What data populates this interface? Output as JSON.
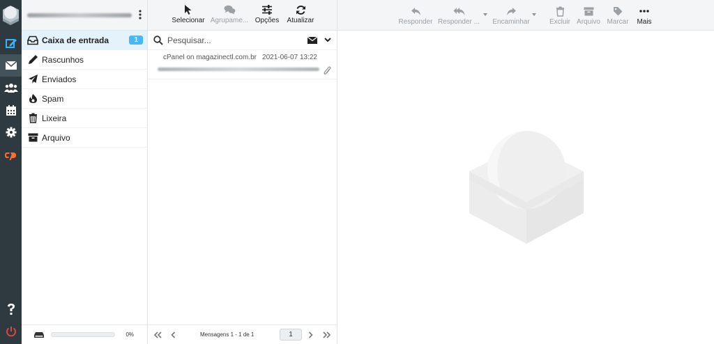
{
  "nav": {
    "icons": [
      "compose-icon",
      "mail-icon",
      "contacts-icon",
      "calendar-icon",
      "settings-icon",
      "cpanel-icon",
      "help-icon",
      "logout-icon"
    ]
  },
  "folders": {
    "items": [
      {
        "label": "Caixa de entrada",
        "icon": "inbox-icon",
        "badge": "1"
      },
      {
        "label": "Rascunhos",
        "icon": "pencil-icon"
      },
      {
        "label": "Enviados",
        "icon": "paper-plane-icon"
      },
      {
        "label": "Spam",
        "icon": "fire-icon"
      },
      {
        "label": "Lixeira",
        "icon": "trash-icon"
      },
      {
        "label": "Arquivo",
        "icon": "archive-icon"
      }
    ],
    "quota_percent": "0%"
  },
  "message_toolbar": {
    "select": "Selecionar",
    "group": "Agrupame...",
    "options": "Opções",
    "refresh": "Atualizar"
  },
  "search": {
    "placeholder": "Pesquisar..."
  },
  "messages": [
    {
      "from": "cPanel on magazinectl.com.br",
      "date": "2021-06-07 13:22",
      "has_attachment": true
    }
  ],
  "pager": {
    "count_text": "Mensagens 1 - 1 de 1",
    "page": "1"
  },
  "preview_toolbar": {
    "reply": "Responder",
    "reply_all": "Responder ...",
    "forward": "Encaminhar",
    "delete": "Excluir",
    "archive": "Arquivo",
    "mark": "Marcar",
    "more": "Mais"
  },
  "colors": {
    "accent": "#46b8f3",
    "nav_bg": "#2f3a40",
    "cpanel_orange": "#ff6c2c",
    "logout_red": "#e0463a"
  }
}
